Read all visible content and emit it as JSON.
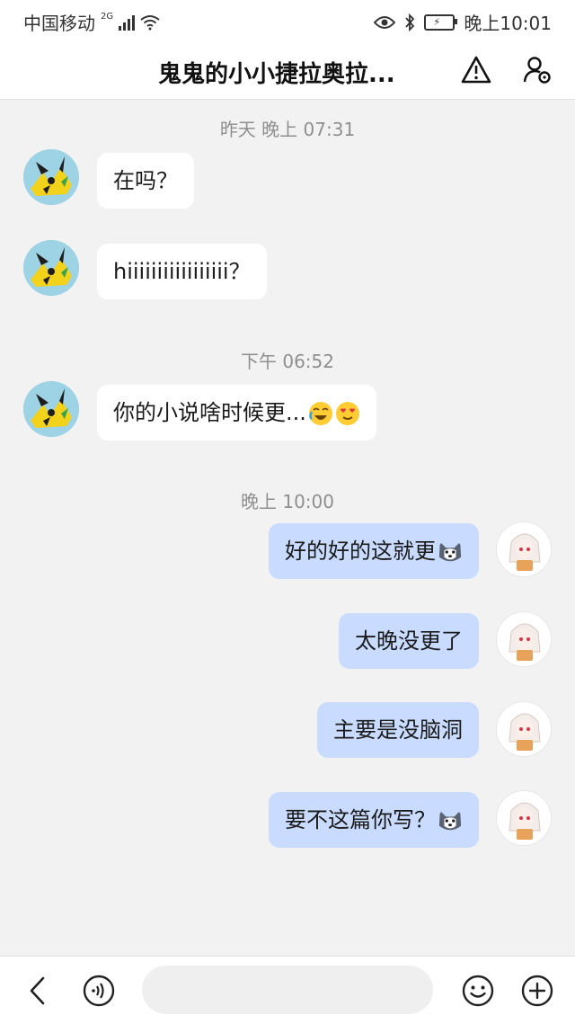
{
  "status_bar": {
    "carrier": "中国移动",
    "network": "2G",
    "time": "晚上10:01"
  },
  "header": {
    "title": "鬼鬼的小小捷拉奥拉...",
    "icons": [
      "back-icon",
      "alert-triangle-icon",
      "user-settings-icon"
    ]
  },
  "messages": [
    {
      "type": "timestamp",
      "text": "昨天 晚上 07:31"
    },
    {
      "type": "incoming",
      "text": "在吗？"
    },
    {
      "type": "incoming",
      "text": "hiiiiiiiiiiiiiiiii？"
    },
    {
      "type": "timestamp",
      "text": "下午 06:52"
    },
    {
      "type": "incoming",
      "text": "你的小说啥时候更...",
      "emojis": [
        "laughing-crying-emoji",
        "heart-eyes-emoji"
      ]
    },
    {
      "type": "timestamp",
      "text": "晚上 10:00"
    },
    {
      "type": "outgoing",
      "text": "好的好的这就更",
      "emojis": [
        "husky-emoji"
      ]
    },
    {
      "type": "outgoing",
      "text": "太晚没更了"
    },
    {
      "type": "outgoing",
      "text": "主要是没脑洞"
    },
    {
      "type": "outgoing",
      "text": "要不这篇你写？",
      "emojis": [
        "husky-emoji"
      ]
    }
  ],
  "bottom_bar": {
    "input_value": "",
    "icons": [
      "back-icon",
      "voice-icon",
      "emoji-icon",
      "add-icon"
    ]
  },
  "colors": {
    "outgoing_bubble": "#c9dcff",
    "incoming_bubble": "#ffffff",
    "chat_background": "#f2f2f2"
  }
}
